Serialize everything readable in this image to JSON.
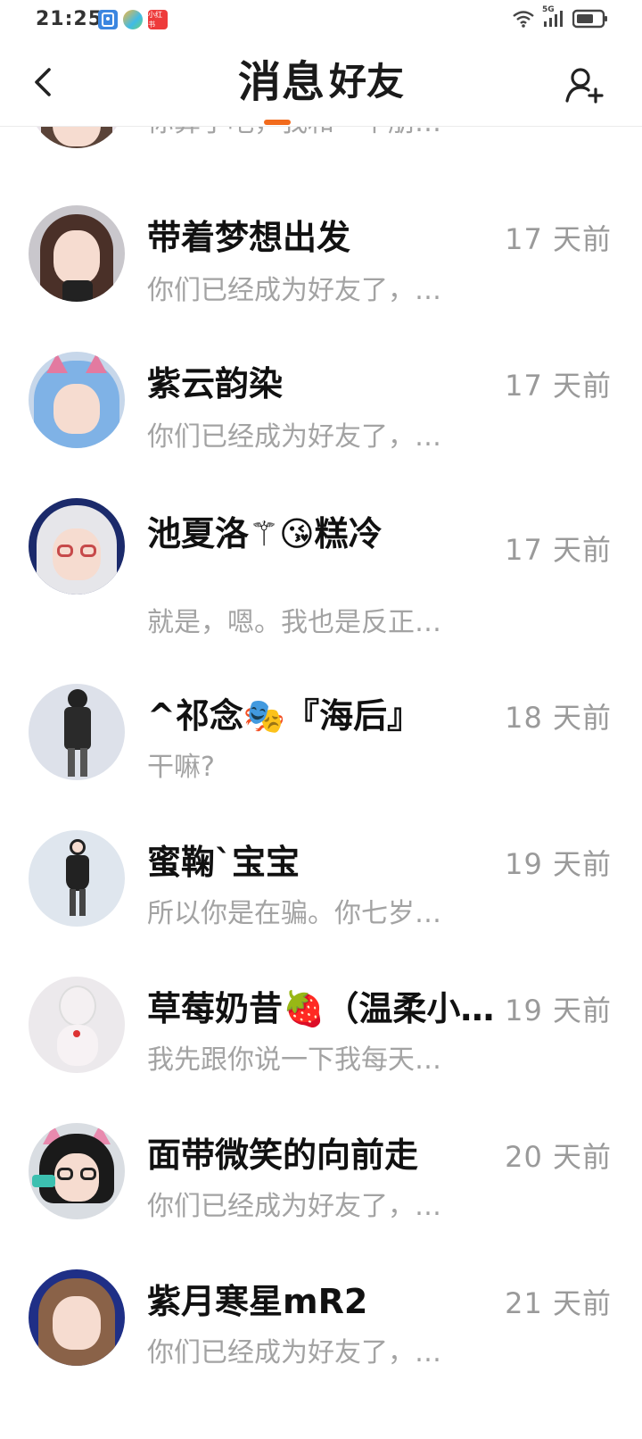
{
  "status_bar": {
    "time": "21:25",
    "network": "5G",
    "app_icons": [
      {
        "name": "app-blue-icon",
        "color": "#3b86e0",
        "label": ""
      },
      {
        "name": "app-colorful-icon",
        "color": "#3fbbe8",
        "label": ""
      },
      {
        "name": "app-red-icon",
        "color": "#ee3b3b",
        "label": "小红书"
      }
    ]
  },
  "header": {
    "tabs": [
      {
        "label": "消息",
        "active": true
      },
      {
        "label": "好友",
        "active": false
      }
    ],
    "accent_color": "#f26b1d"
  },
  "conversations": [
    {
      "name": "",
      "time": "",
      "preview": "你算了吧，我和一个朋…",
      "avatar_color": "#e9e3ea"
    },
    {
      "name": "带着梦想出发",
      "time": "17 天前",
      "preview": "你们已经成为好友了，…",
      "avatar_color": "#c9c7cc"
    },
    {
      "name": "紫云韵染",
      "time": "17 天前",
      "preview": "你们已经成为好友了，…",
      "avatar_color": "#c7d7ea"
    },
    {
      "name": "池夏洛⚚😘糕冷",
      "time": "17 天前",
      "preview": "就是，嗯。我也是反正…",
      "avatar_color": "#1b2a6b"
    },
    {
      "name": "^祁念🎭『海后』",
      "time": "18 天前",
      "preview": "干嘛?",
      "avatar_color": "#dde1ea"
    },
    {
      "name": "蜜鞠`宝宝",
      "time": "19 天前",
      "preview": "所以你是在骗。你七岁…",
      "avatar_color": "#dfe6ee"
    },
    {
      "name": "草莓奶昔🍓（温柔小…",
      "time": "19 天前",
      "preview": "我先跟你说一下我每天…",
      "avatar_color": "#ece9ec"
    },
    {
      "name": "面带微笑的向前走",
      "time": "20 天前",
      "preview": "你们已经成为好友了，…",
      "avatar_color": "#d9dde2"
    },
    {
      "name": "紫月寒星mR2",
      "time": "21 天前",
      "preview": "你们已经成为好友了，…",
      "avatar_color": "#1f2f86"
    }
  ]
}
